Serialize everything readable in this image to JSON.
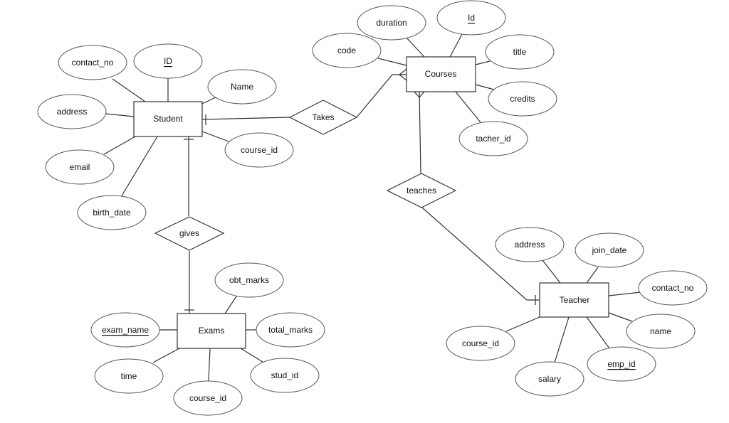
{
  "diagram": {
    "type": "entity-relationship",
    "entities": [
      {
        "id": "student",
        "label": "Student",
        "attributes": [
          {
            "label": "contact_no",
            "key": false
          },
          {
            "label": "ID",
            "key": true
          },
          {
            "label": "Name",
            "key": false
          },
          {
            "label": "address",
            "key": false
          },
          {
            "label": "email",
            "key": false
          },
          {
            "label": "birth_date",
            "key": false
          },
          {
            "label": "course_id",
            "key": false
          }
        ]
      },
      {
        "id": "courses",
        "label": "Courses",
        "attributes": [
          {
            "label": "duration",
            "key": false
          },
          {
            "label": "Id",
            "key": true
          },
          {
            "label": "code",
            "key": false
          },
          {
            "label": "title",
            "key": false
          },
          {
            "label": "credits",
            "key": false
          },
          {
            "label": "tacher_id",
            "key": false
          }
        ]
      },
      {
        "id": "exams",
        "label": "Exams",
        "attributes": [
          {
            "label": "obt_marks",
            "key": false
          },
          {
            "label": "exam_name",
            "key": true
          },
          {
            "label": "total_marks",
            "key": false
          },
          {
            "label": "time",
            "key": false
          },
          {
            "label": "course_id",
            "key": false
          },
          {
            "label": "stud_id",
            "key": false
          }
        ]
      },
      {
        "id": "teacher",
        "label": "Teacher",
        "attributes": [
          {
            "label": "address",
            "key": false
          },
          {
            "label": "join_date",
            "key": false
          },
          {
            "label": "contact_no",
            "key": false
          },
          {
            "label": "name",
            "key": false
          },
          {
            "label": "course_id",
            "key": false
          },
          {
            "label": "salary",
            "key": false
          },
          {
            "label": "emp_id",
            "key": true
          }
        ]
      }
    ],
    "relationships": [
      {
        "id": "takes",
        "label": "Takes",
        "from": "student",
        "from_cardinality": "one",
        "to": "courses",
        "to_cardinality": "many"
      },
      {
        "id": "gives",
        "label": "gives",
        "from": "student",
        "from_cardinality": "one",
        "to": "exams",
        "to_cardinality": "one"
      },
      {
        "id": "teaches",
        "label": "teaches",
        "from": "courses",
        "from_cardinality": "many",
        "to": "teacher",
        "to_cardinality": "one"
      }
    ]
  }
}
